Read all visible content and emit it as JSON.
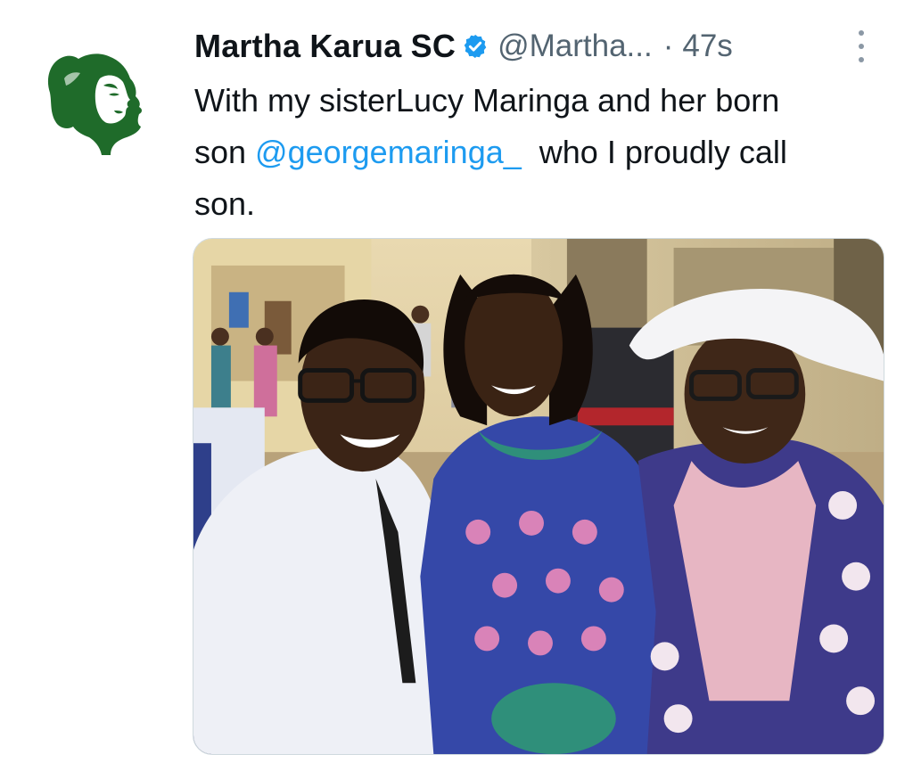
{
  "tweet": {
    "author_name": "Martha Karua SC",
    "handle": "@Martha...",
    "separator": "·",
    "timestamp": "47s",
    "text_line1": "With my sisterLucy Maringa and her born",
    "text_line2_prefix": "son ",
    "mention": "@georgemaringa_",
    "text_line2_suffix": "  who I proudly call",
    "text_line3": "son."
  },
  "icons": {
    "verified": "verified-badge-icon",
    "more": "more-options-icon",
    "avatar": "avatar-silhouette"
  },
  "colors": {
    "text": "#0f1419",
    "secondary_text": "#536471",
    "link": "#1d9bf0",
    "verified": "#1d9bf0",
    "avatar_green": "#1f6b2a"
  }
}
